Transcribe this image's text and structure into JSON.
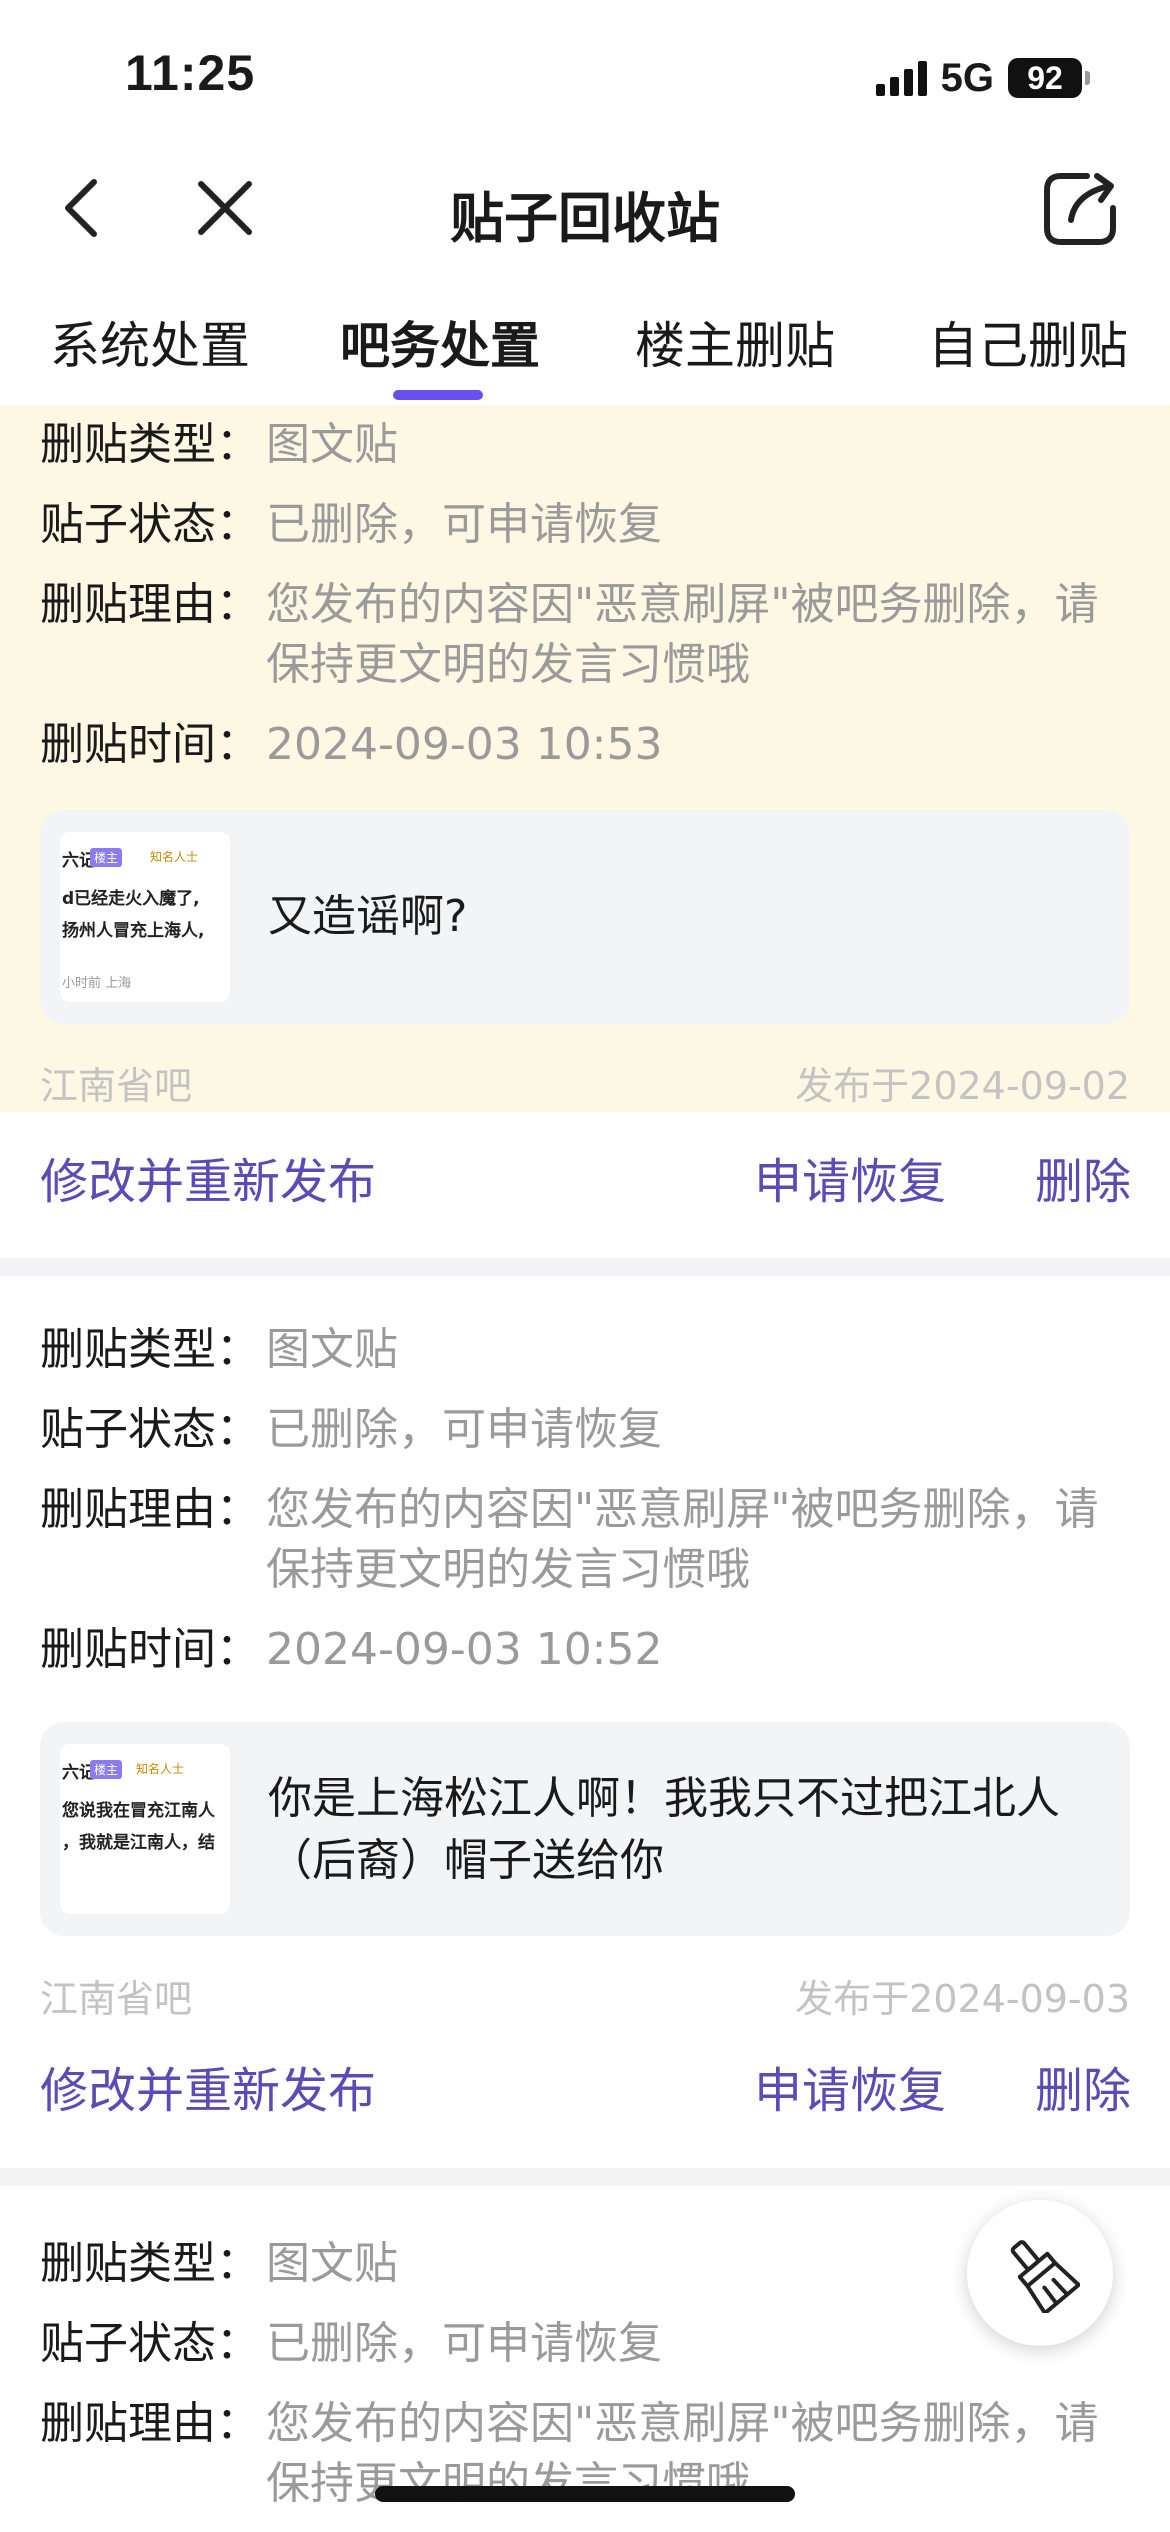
{
  "status_bar": {
    "time": "11:25",
    "network": "5G",
    "battery": "92"
  },
  "nav": {
    "title": "贴子回收站"
  },
  "tabs": [
    {
      "label": "系统处置"
    },
    {
      "label": "吧务处置"
    },
    {
      "label": "楼主删贴"
    },
    {
      "label": "自己删贴"
    }
  ],
  "active_tab": 1,
  "records": [
    {
      "type_label": "删贴类型：",
      "type_value": "图文贴",
      "status_label": "贴子状态：",
      "status_value": "已删除，可申请恢复",
      "reason_label": "删贴理由：",
      "reason_value": "您发布的内容因\"恶意刷屏\"被吧务删除，请保持更文明的发言习惯哦",
      "time_label": "删贴时间：",
      "time_value": "2024-09-03 10:53",
      "thumb_line1": "六记",
      "thumb_badge": "楼主",
      "thumb_badge2": "知名人士",
      "thumb_line2": "d已经走火入魔了,",
      "thumb_line3": "扬州人冒充上海人,",
      "thumb_meta": "小时前  上海",
      "quote": "又造谣啊?",
      "forum": "江南省吧",
      "published": "发布于2024-09-02",
      "edit_label": "修改并重新发布",
      "restore_label": "申请恢复",
      "delete_label": "删除"
    },
    {
      "type_label": "删贴类型：",
      "type_value": "图文贴",
      "status_label": "贴子状态：",
      "status_value": "已删除，可申请恢复",
      "reason_label": "删贴理由：",
      "reason_value": "您发布的内容因\"恶意刷屏\"被吧务删除，请保持更文明的发言习惯哦",
      "time_label": "删贴时间：",
      "time_value": "2024-09-03 10:52",
      "thumb_line1": "六记",
      "thumb_badge": "楼主",
      "thumb_badge2": "知名人士",
      "thumb_line2": "您说我在冒充江南人",
      "thumb_line3": "，我就是江南人，结",
      "thumb_meta": "",
      "quote": "你是上海松江人啊！我我只不过把江北人（后裔）帽子送给你",
      "forum": "江南省吧",
      "published": "发布于2024-09-03",
      "edit_label": "修改并重新发布",
      "restore_label": "申请恢复",
      "delete_label": "删除"
    },
    {
      "type_label": "删贴类型：",
      "type_value": "图文贴",
      "status_label": "贴子状态：",
      "status_value": "已删除，可申请恢复",
      "reason_label": "删贴理由：",
      "reason_value": "您发布的内容因\"恶意刷屏\"被吧务删除，请保持更文明的发言习惯哦"
    }
  ],
  "icons": {
    "back": "chevron-left-icon",
    "close": "close-icon",
    "share": "share-icon",
    "fab": "broom-icon"
  },
  "colors": {
    "accent": "#5a4bb6",
    "tab_indicator": "#6b4ef0",
    "highlight_bg": "#fdf8e3"
  }
}
